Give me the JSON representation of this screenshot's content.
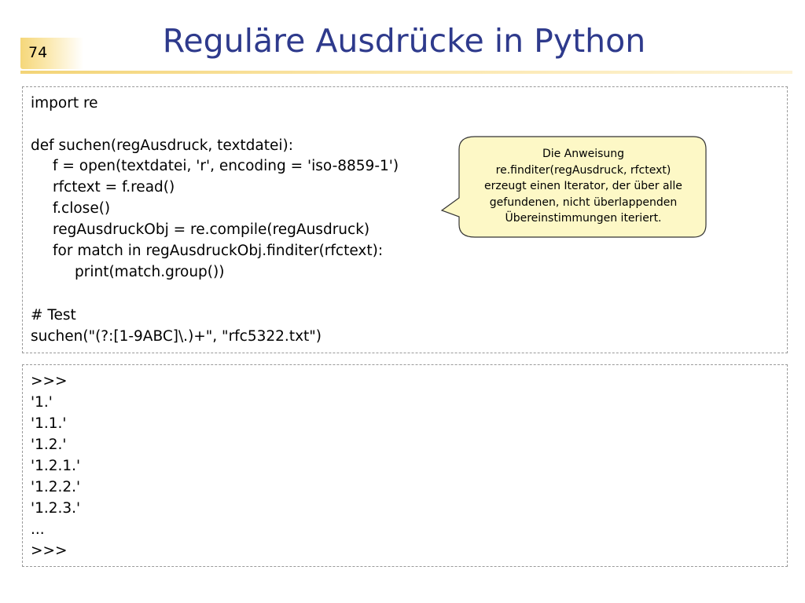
{
  "slide": {
    "number": "74",
    "title": "Reguläre Ausdrücke in Python"
  },
  "code": {
    "lines": [
      "import re",
      "def suchen(regAusdruck, textdatei):",
      "f = open(textdatei, 'r', encoding = 'iso-8859-1')",
      "rfctext = f.read()",
      "f.close()",
      "regAusdruckObj = re.compile(regAusdruck)",
      "for match in regAusdruckObj.finditer(rfctext):",
      "print(match.group())",
      "# Test",
      "suchen(\"(?:[1-9ABC]\\.)+\", \"rfc5322.txt\")"
    ]
  },
  "callout": {
    "lines": [
      "Die Anweisung",
      "re.finditer(regAusdruck, rfctext)",
      "erzeugt einen Iterator, der über alle",
      "gefundenen, nicht überlappenden",
      "Übereinstimmungen iteriert."
    ]
  },
  "output": {
    "lines": [
      ">>>",
      "'1.'",
      "'1.1.'",
      "'1.2.'",
      "'1.2.1.'",
      "'1.2.2.'",
      "'1.2.3.'",
      "...",
      ">>>"
    ]
  },
  "colors": {
    "title": "#2e3a8c",
    "accent": "#f3d477",
    "callout_fill": "#fdf8c6"
  }
}
